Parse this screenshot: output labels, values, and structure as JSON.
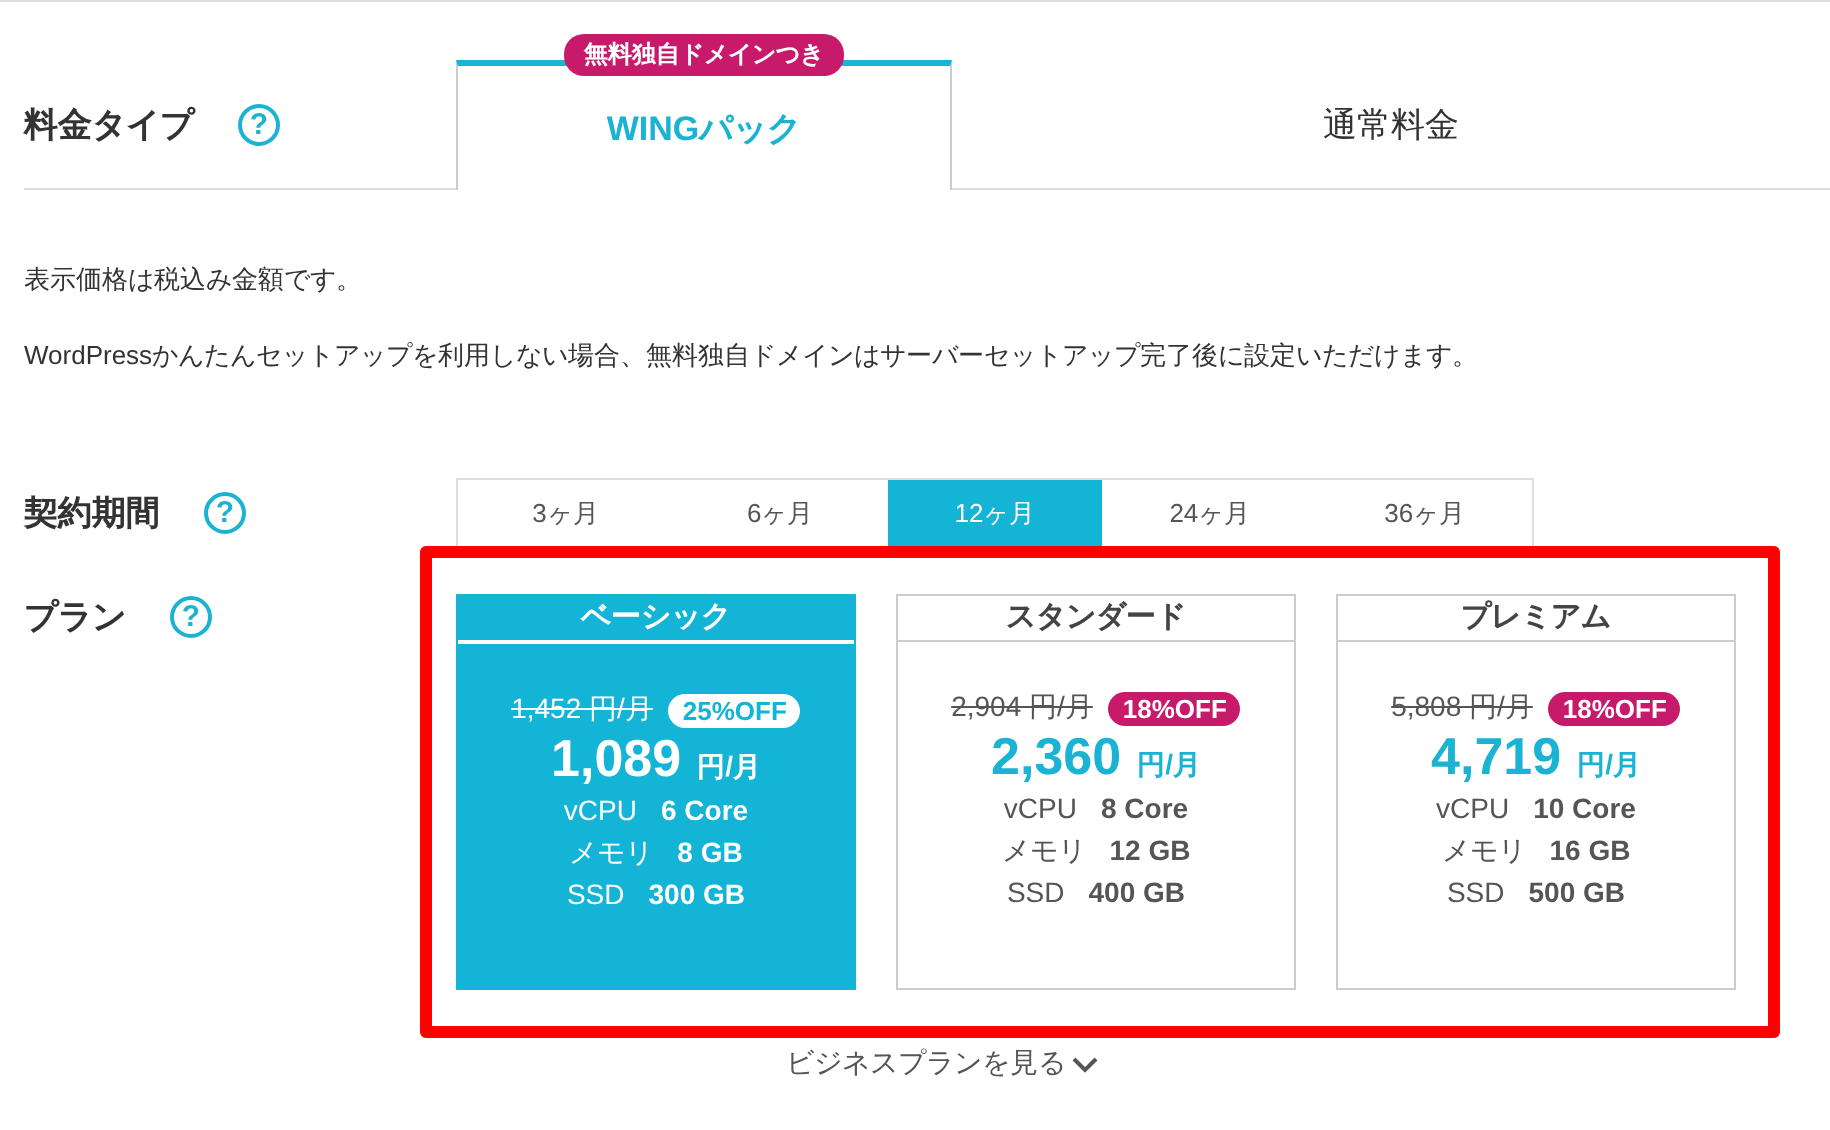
{
  "pricing_type": {
    "label": "料金タイプ",
    "help": "?",
    "tabs": [
      {
        "label": "WINGパック",
        "selected": true,
        "badge": "無料独自ドメインつき"
      },
      {
        "label": "通常料金",
        "selected": false
      }
    ]
  },
  "notes": [
    "表示価格は税込み金額です。",
    "WordPressかんたんセットアップを利用しない場合、無料独自ドメインはサーバーセットアップ完了後に設定いただけます。"
  ],
  "contract_period": {
    "label": "契約期間",
    "help": "?",
    "options": [
      {
        "label": "3ヶ月",
        "selected": false
      },
      {
        "label": "6ヶ月",
        "selected": false
      },
      {
        "label": "12ヶ月",
        "selected": true
      },
      {
        "label": "24ヶ月",
        "selected": false
      },
      {
        "label": "36ヶ月",
        "selected": false
      }
    ]
  },
  "plan": {
    "label": "プラン",
    "help": "?",
    "cards": [
      {
        "name": "ベーシック",
        "selected": true,
        "original_price": "1,452 円/月",
        "discount": "25%OFF",
        "price": "1,089",
        "price_unit": "円/月",
        "specs": [
          {
            "label": "vCPU",
            "value": "6 Core"
          },
          {
            "label": "メモリ",
            "value": "8 GB"
          },
          {
            "label": "SSD",
            "value": "300 GB"
          }
        ]
      },
      {
        "name": "スタンダード",
        "selected": false,
        "original_price": "2,904 円/月",
        "discount": "18%OFF",
        "price": "2,360",
        "price_unit": "円/月",
        "specs": [
          {
            "label": "vCPU",
            "value": "8 Core"
          },
          {
            "label": "メモリ",
            "value": "12 GB"
          },
          {
            "label": "SSD",
            "value": "400 GB"
          }
        ]
      },
      {
        "name": "プレミアム",
        "selected": false,
        "original_price": "5,808 円/月",
        "discount": "18%OFF",
        "price": "4,719",
        "price_unit": "円/月",
        "specs": [
          {
            "label": "vCPU",
            "value": "10 Core"
          },
          {
            "label": "メモリ",
            "value": "16 GB"
          },
          {
            "label": "SSD",
            "value": "500 GB"
          }
        ]
      }
    ]
  },
  "more_link": "ビジネスプランを見る"
}
